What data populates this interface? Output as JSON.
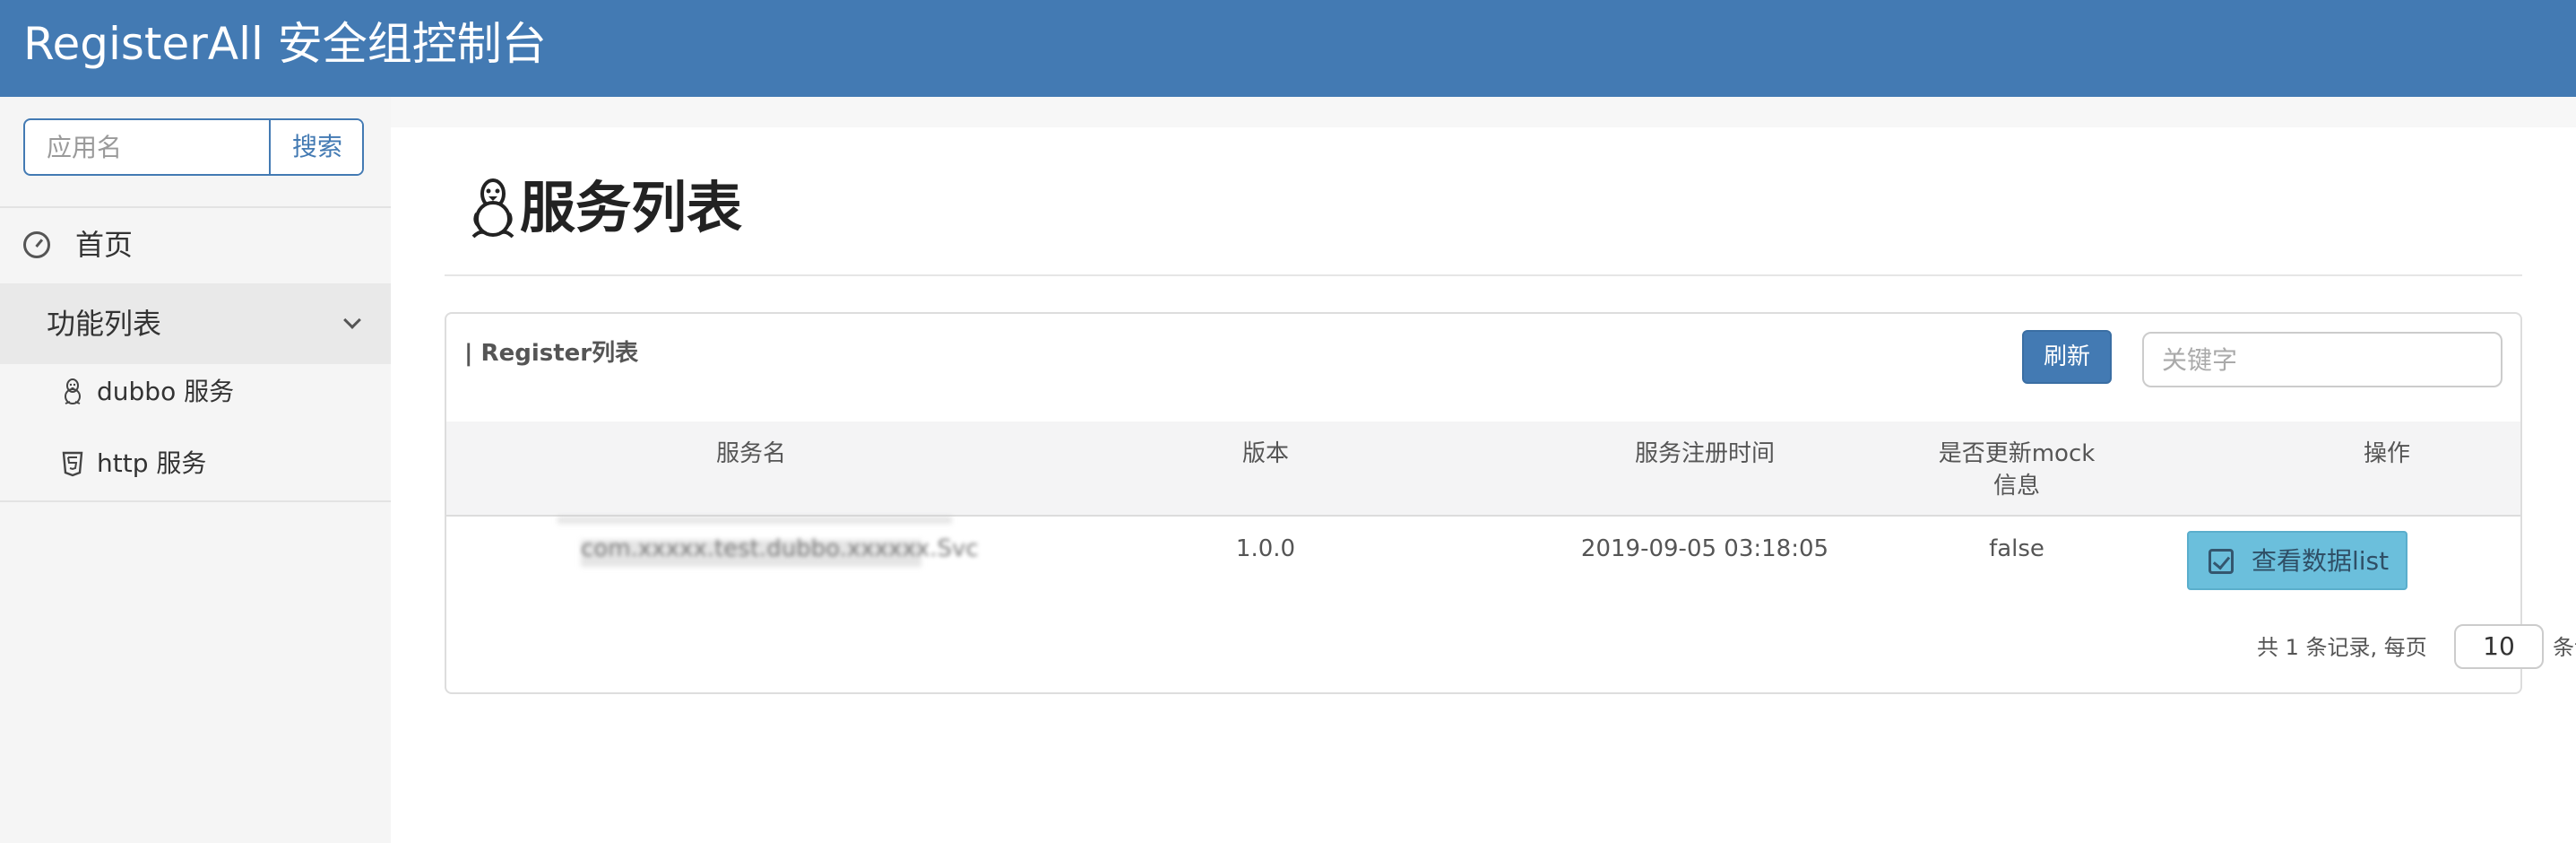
{
  "app": {
    "title": "RegisterAll 安全组控制台"
  },
  "sidebar": {
    "search": {
      "placeholder": "应用名",
      "button_label": "搜索"
    },
    "home": {
      "label": "首页",
      "icon": "dashboard-icon"
    },
    "group": {
      "label": "功能列表",
      "icon": "chevron-down-icon",
      "items": [
        {
          "label": "dubbo 服务",
          "icon": "penguin-icon"
        },
        {
          "label": "http 服务",
          "icon": "html5-icon"
        }
      ]
    }
  },
  "main": {
    "page_title": "服务列表",
    "page_title_icon": "penguin-icon",
    "panel": {
      "title": "| Register列表",
      "refresh_label": "刷新",
      "keyword_placeholder": "关键字",
      "columns": [
        "服务名",
        "版本",
        "服务注册时间",
        "是否更新mock",
        "信息",
        "操作"
      ],
      "rows": [
        {
          "service_name": "com.xxxxx.test.dubbo.xxxxxx.Svc",
          "version": "1.0.0",
          "registered_at": "2019-09-05 03:18:05",
          "mock_updated": "false",
          "action_label": "查看数据list",
          "action_icon": "check-square-icon"
        }
      ],
      "pager": {
        "prefix": "共 1 条记录, 每页",
        "page_size": "10",
        "suffix": "条记录"
      }
    }
  },
  "colors": {
    "header_bg": "#437ab3",
    "primary": "#437ab3",
    "info_button": "#6bbfdc",
    "sidebar_bg": "#f5f5f5",
    "active_group_bg": "#e9e9e9"
  }
}
